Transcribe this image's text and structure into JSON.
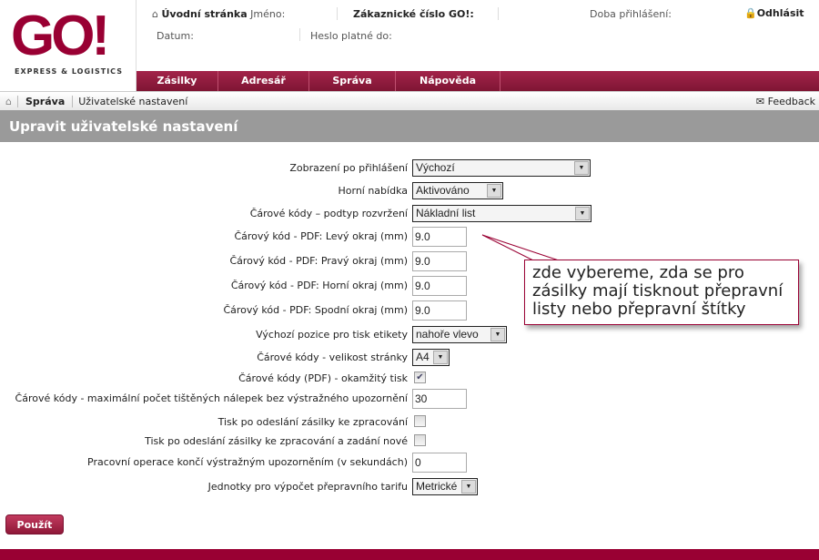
{
  "logo": {
    "text": "GO!",
    "subtitle": "EXPRESS & LOGISTICS"
  },
  "header": {
    "home": "Úvodní stránka",
    "name_label": "Jméno:",
    "customer_label": "Zákaznické číslo GO!:",
    "login_time_label": "Doba přihlášení:",
    "logout": "Odhlásit",
    "date_label": "Datum:",
    "password_label": "Heslo platné do:"
  },
  "nav": [
    "Zásilky",
    "Adresář",
    "Správa",
    "Nápověda"
  ],
  "breadcrumb": {
    "section": "Správa",
    "page": "Uživatelské nastavení",
    "feedback": "Feedback"
  },
  "title": "Upravit uživatelské nastavení",
  "form": [
    {
      "label": "Zobrazení po přihlášení",
      "type": "select",
      "value": "Výchozí"
    },
    {
      "label": "Horní nabídka",
      "type": "select",
      "value": "Aktivováno"
    },
    {
      "label": "Čárové kódy – podtyp rozvržení",
      "type": "select",
      "value": "Nákladní list"
    },
    {
      "label": "Čárový kód - PDF: Levý okraj (mm)",
      "type": "input",
      "value": "9.0"
    },
    {
      "label": "Čárový kód - PDF: Pravý okraj (mm)",
      "type": "input",
      "value": "9.0"
    },
    {
      "label": "Čárový kód - PDF: Horní okraj (mm)",
      "type": "input",
      "value": "9.0"
    },
    {
      "label": "Čárový kód - PDF: Spodní okraj (mm)",
      "type": "input",
      "value": "9.0"
    },
    {
      "label": "Výchozí pozice pro tisk etikety",
      "type": "select",
      "value": "nahoře vlevo"
    },
    {
      "label": "Čárové kódy - velikost stránky",
      "type": "select",
      "value": "A4"
    },
    {
      "label": "Čárové kódy (PDF) - okamžitý tisk",
      "type": "checkbox",
      "checked": true
    },
    {
      "label": "Čárové kódy - maximální počet tištěných nálepek bez výstražného upozornění",
      "type": "input",
      "value": "30"
    },
    {
      "label": "Tisk po odeslání zásilky ke zpracování",
      "type": "checkbox",
      "checked": false
    },
    {
      "label": "Tisk po odeslání zásilky ke zpracování a zadání nové",
      "type": "checkbox",
      "checked": false
    },
    {
      "label": "Pracovní operace končí výstražným upozorněním (v sekundách)",
      "type": "input",
      "value": "0"
    },
    {
      "label": "Jednotky pro výpočet přepravního tarifu",
      "type": "select",
      "value": "Metrické"
    }
  ],
  "apply": "Použít",
  "callout": {
    "text": "zde vybereme, zda se pro zásilky mají tisknout přepravní listy nebo přepravní štítky"
  },
  "colors": {
    "brand": "#990033",
    "title_bar": "#9a9a9a"
  }
}
